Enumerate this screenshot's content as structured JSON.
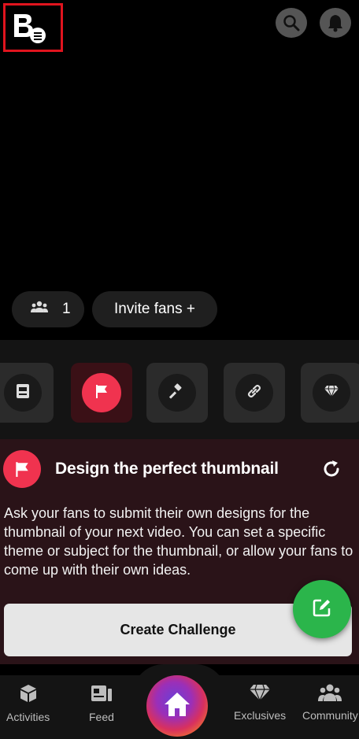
{
  "header": {
    "logo_icon": "creator-logo-icon",
    "search_icon": "search-icon",
    "notifications_icon": "bell-icon"
  },
  "stats": {
    "fans_icon": "people-icon",
    "fans_count": "1",
    "invite_label": "Invite fans +"
  },
  "tools": [
    {
      "icon": "card-icon",
      "active": false
    },
    {
      "icon": "flag-icon",
      "active": true
    },
    {
      "icon": "gavel-icon",
      "active": false
    },
    {
      "icon": "link-icon",
      "active": false
    },
    {
      "icon": "diamond-icon",
      "active": false
    }
  ],
  "challenge": {
    "icon": "flag-icon",
    "title": "Design the perfect thumbnail",
    "refresh_icon": "refresh-icon",
    "description": "Ask your fans to submit their own designs for the thumbnail of your next video. You can set a specific theme or subject for the thumbnail, or allow your fans to come up with their own ideas.",
    "cta_label": "Create Challenge",
    "fab_icon": "edit-icon"
  },
  "bottom_nav": {
    "items": [
      {
        "label": "Activities",
        "icon": "cube-icon"
      },
      {
        "label": "Feed",
        "icon": "feed-icon"
      },
      {
        "label": "",
        "icon": "home-icon"
      },
      {
        "label": "Exclusives",
        "icon": "diamond-icon"
      },
      {
        "label": "Community",
        "icon": "community-icon"
      }
    ]
  },
  "colors": {
    "accent": "#f0334f",
    "fab": "#2bb54b",
    "card_bg": "#2a1318"
  }
}
